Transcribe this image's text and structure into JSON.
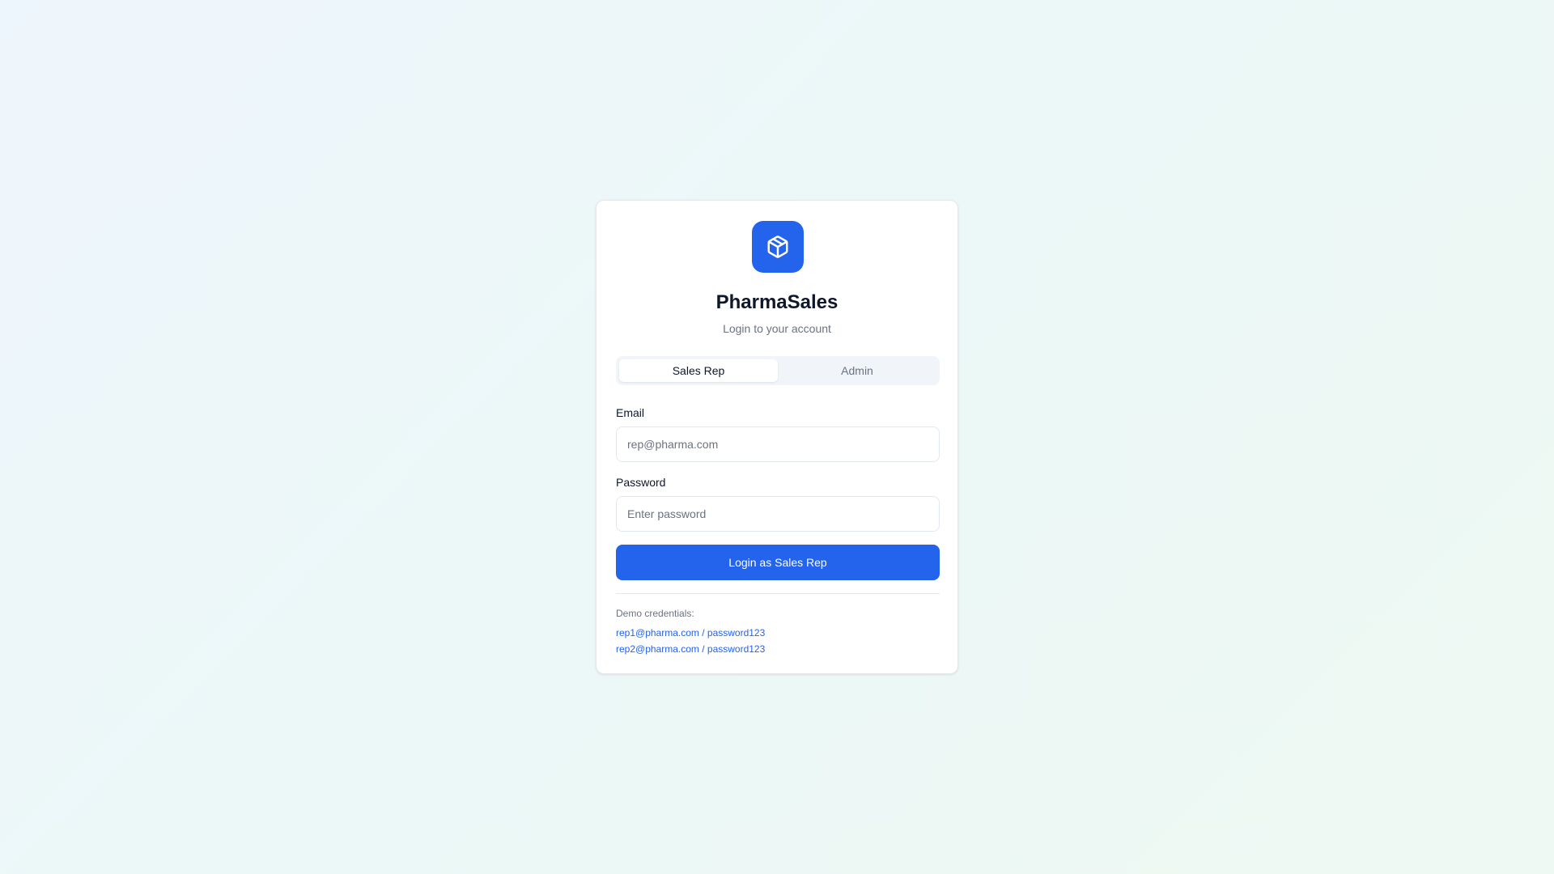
{
  "app": {
    "name": "PharmaSales",
    "subtitle": "Login to your account",
    "logo_icon": "package-box-icon",
    "brand_color": "#2463eb"
  },
  "tabs": [
    {
      "label": "Sales Rep",
      "active": true
    },
    {
      "label": "Admin",
      "active": false
    }
  ],
  "form": {
    "email_label": "Email",
    "email_placeholder": "rep@pharma.com",
    "password_label": "Password",
    "password_placeholder": "Enter password",
    "submit_label": "Login as Sales Rep"
  },
  "demo": {
    "title": "Demo credentials:",
    "credentials": [
      "rep1@pharma.com / password123",
      "rep2@pharma.com / password123"
    ]
  }
}
